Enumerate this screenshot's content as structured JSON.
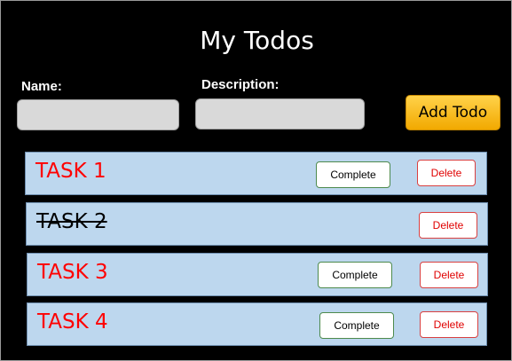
{
  "header": {
    "title": "My Todos"
  },
  "form": {
    "name_label": "Name:",
    "name_value": "",
    "description_label": "Description:",
    "description_value": "",
    "add_button_label": "Add Todo"
  },
  "tasks": [
    {
      "name": "TASK 1",
      "completed": false,
      "complete_label": "Complete",
      "delete_label": "Delete"
    },
    {
      "name": "TASK 2",
      "completed": true,
      "delete_label": "Delete"
    },
    {
      "name": "TASK 3",
      "completed": false,
      "complete_label": "Complete",
      "delete_label": "Delete"
    },
    {
      "name": "TASK 4",
      "completed": false,
      "complete_label": "Complete",
      "delete_label": "Delete"
    }
  ],
  "colors": {
    "task_text": "#ff0000",
    "task_done_text": "#000000",
    "row_background": "#bdd7ee",
    "add_button": "#ffc000"
  }
}
